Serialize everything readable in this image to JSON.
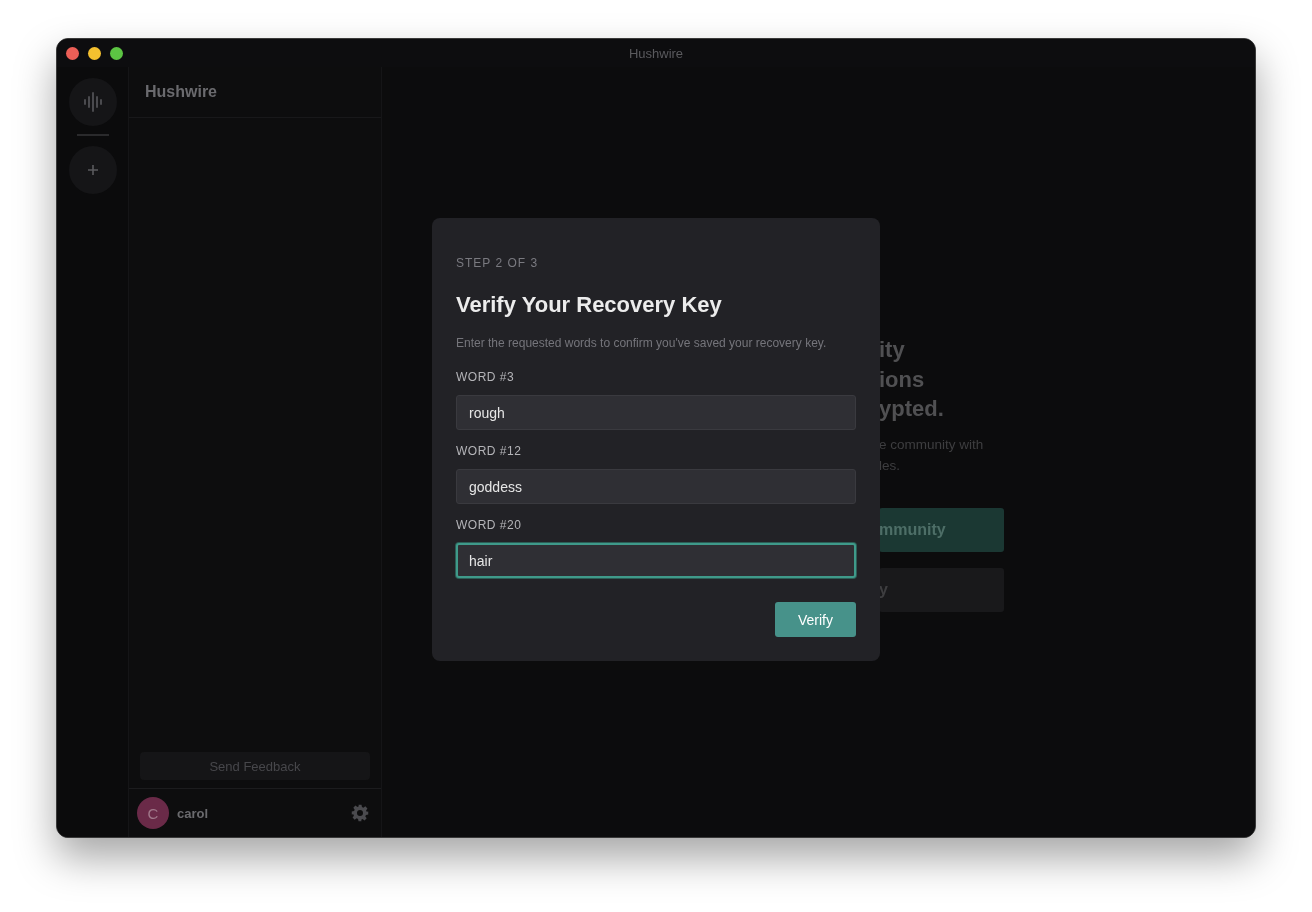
{
  "window": {
    "title": "Hushwire"
  },
  "sidebar": {
    "title": "Hushwire",
    "feedback_button": "Send Feedback",
    "user": {
      "avatar_letter": "C",
      "name": "carol"
    }
  },
  "background": {
    "heading_lines": [
      "ity",
      "ions",
      "ypted."
    ],
    "text_lines": [
      "e community with",
      "les."
    ],
    "buttons": [
      {
        "label": "mmunity",
        "kind": "primary"
      },
      {
        "label": "y",
        "kind": "secondary"
      }
    ]
  },
  "modal": {
    "step": "STEP 2 OF 3",
    "title": "Verify Your Recovery Key",
    "description": "Enter the requested words to confirm you've saved your recovery key.",
    "fields": [
      {
        "label": "WORD #3",
        "value": "rough",
        "focused": false
      },
      {
        "label": "WORD #12",
        "value": "goddess",
        "focused": false
      },
      {
        "label": "WORD #20",
        "value": "hair",
        "focused": true
      }
    ],
    "submit": "Verify"
  }
}
